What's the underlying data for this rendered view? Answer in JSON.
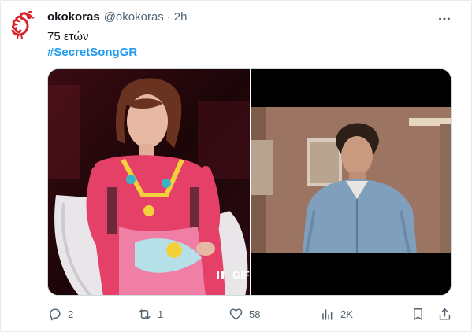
{
  "tweet": {
    "display_name": "okokoras",
    "handle": "@okokoras",
    "separator": "·",
    "time": "2h",
    "text": "75 ετών",
    "hashtag": "#SecretSongGR"
  },
  "media": {
    "gif_label": "GIF"
  },
  "actions": {
    "reply_count": "2",
    "retweet_count": "1",
    "like_count": "58",
    "views_count": "2K"
  },
  "icons": {
    "avatar": "rooster-logo",
    "more": "more-icon",
    "reply": "reply-icon",
    "retweet": "retweet-icon",
    "like": "heart-icon",
    "views": "views-icon",
    "bookmark": "bookmark-icon",
    "share": "share-icon",
    "pause": "pause-icon"
  },
  "colors": {
    "accent": "#1d9bf0",
    "secondary_text": "#536471",
    "brand_red": "#d7262b"
  }
}
